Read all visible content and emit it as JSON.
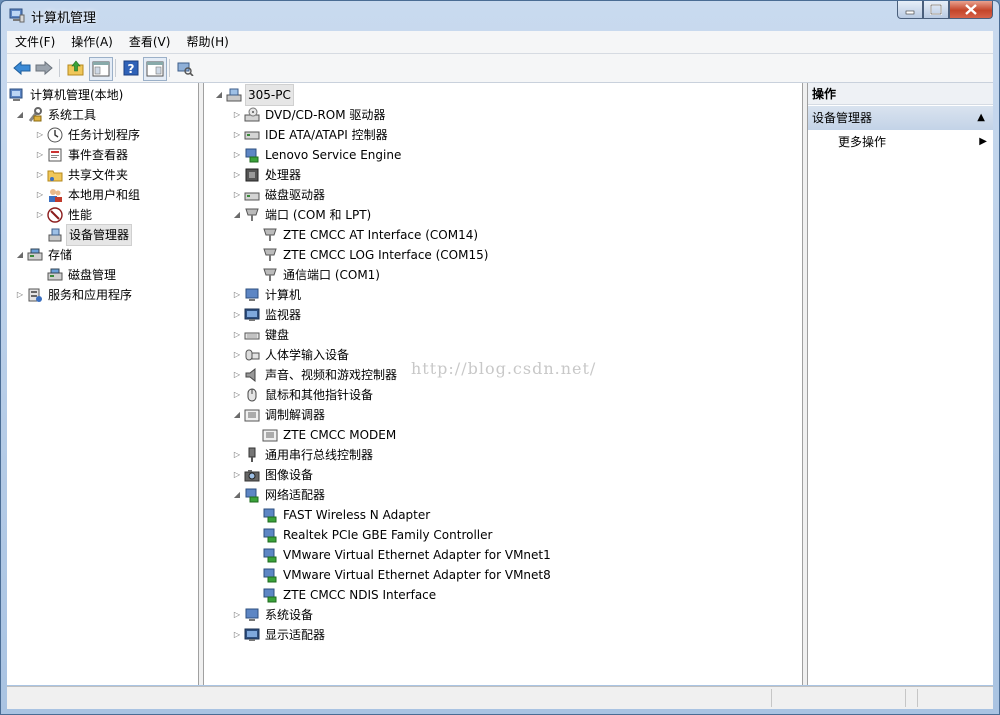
{
  "window": {
    "title": "计算机管理",
    "accent": "#4a6c94",
    "close_color": "#c4452a"
  },
  "menu": [
    {
      "label": "文件(F)"
    },
    {
      "label": "操作(A)"
    },
    {
      "label": "查看(V)"
    },
    {
      "label": "帮助(H)"
    }
  ],
  "toolbar": {
    "icons": [
      "back-arrow-icon",
      "forward-arrow-icon",
      "up-folder-icon",
      "show-hide-console-tree-icon",
      "help-icon",
      "show-hide-action-pane-icon",
      "scan-hardware-icon"
    ]
  },
  "left_tree": {
    "root": "计算机管理(本地)",
    "system_tools": "系统工具",
    "task_scheduler": "任务计划程序",
    "event_viewer": "事件查看器",
    "shared_folders": "共享文件夹",
    "local_users": "本地用户和组",
    "performance": "性能",
    "device_manager": "设备管理器",
    "storage": "存储",
    "disk_management": "磁盘管理",
    "services_apps": "服务和应用程序"
  },
  "device_tree": {
    "root": "305-PC",
    "dvd": "DVD/CD-ROM 驱动器",
    "ide": "IDE ATA/ATAPI 控制器",
    "lenovo": "Lenovo Service Engine",
    "cpu": "处理器",
    "disk": "磁盘驱动器",
    "ports": "端口 (COM 和 LPT)",
    "port1": "ZTE CMCC AT Interface (COM14)",
    "port2": "ZTE CMCC LOG Interface (COM15)",
    "port3": "通信端口 (COM1)",
    "computer": "计算机",
    "monitor": "监视器",
    "keyboard": "键盘",
    "hid": "人体学输入设备",
    "sound": "声音、视频和游戏控制器",
    "mouse": "鼠标和其他指针设备",
    "modem": "调制解调器",
    "modem1": "ZTE CMCC MODEM",
    "usb": "通用串行总线控制器",
    "imaging": "图像设备",
    "network": "网络适配器",
    "net1": "FAST Wireless N Adapter",
    "net2": "Realtek PCIe GBE Family Controller",
    "net3": "VMware Virtual Ethernet Adapter for VMnet1",
    "net4": "VMware Virtual Ethernet Adapter for VMnet8",
    "net5": "ZTE CMCC NDIS Interface",
    "system": "系统设备",
    "display": "显示适配器"
  },
  "actions": {
    "header": "操作",
    "group": "设备管理器",
    "more": "更多操作"
  },
  "watermark": "http://blog.csdn.net/"
}
